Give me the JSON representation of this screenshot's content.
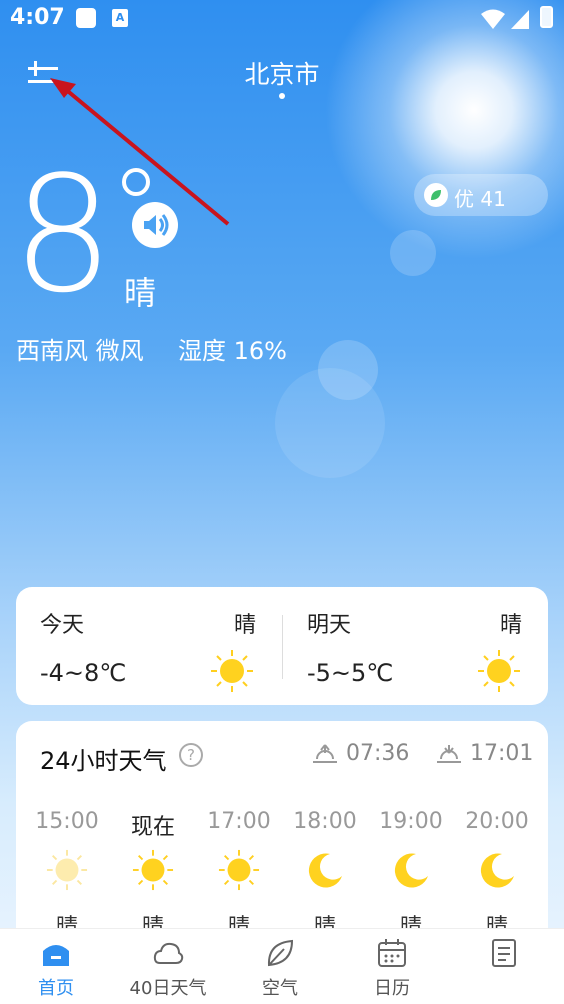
{
  "status_bar": {
    "time": "4:07"
  },
  "header": {
    "city": "北京市"
  },
  "current": {
    "temperature": "8",
    "condition": "晴",
    "wind": "西南风 微风",
    "humidity": "湿度 16%",
    "aqi": "优 41"
  },
  "forecast": {
    "today": {
      "label": "今天",
      "condition": "晴",
      "range": "-4~8℃"
    },
    "tomorrow": {
      "label": "明天",
      "condition": "晴",
      "range": "-5~5℃"
    }
  },
  "hourly": {
    "title": "24小时天气",
    "help": "?",
    "sunrise": "07:36",
    "sunset": "17:01",
    "hours": [
      {
        "time": "15:00",
        "condition": "晴",
        "icon": "sun-icon"
      },
      {
        "time": "现在",
        "condition": "晴",
        "icon": "sun-icon"
      },
      {
        "time": "17:00",
        "condition": "晴",
        "icon": "sun-icon"
      },
      {
        "time": "18:00",
        "condition": "晴",
        "icon": "moon-icon"
      },
      {
        "time": "19:00",
        "condition": "晴",
        "icon": "moon-icon"
      },
      {
        "time": "20:00",
        "condition": "晴",
        "icon": "moon-icon"
      }
    ]
  },
  "nav": {
    "items": [
      {
        "label": "首页",
        "icon": "home-icon",
        "active": true
      },
      {
        "label": "40日天气",
        "icon": "cloud-icon",
        "active": false
      },
      {
        "label": "空气",
        "icon": "leaf-icon",
        "active": false
      },
      {
        "label": "日历",
        "icon": "calendar-icon",
        "active": false
      },
      {
        "label": "",
        "icon": "news-icon",
        "active": false
      }
    ]
  },
  "colors": {
    "accent": "#2f8ff0",
    "sun": "#ffd21f",
    "arrow": "#d11a1a"
  }
}
